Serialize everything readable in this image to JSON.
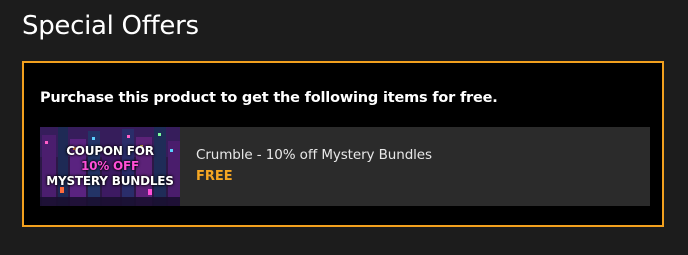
{
  "section": {
    "title": "Special Offers"
  },
  "offer": {
    "heading": "Purchase this product to get the following items for free.",
    "border_color": "#f2a01e",
    "items": [
      {
        "thumbnail": {
          "line1": "COUPON FOR",
          "line2": "10% OFF",
          "line3": "MYSTERY BUNDLES"
        },
        "name": "Crumble - 10% off Mystery Bundles",
        "price": "FREE",
        "price_color": "#f5a623"
      }
    ]
  }
}
